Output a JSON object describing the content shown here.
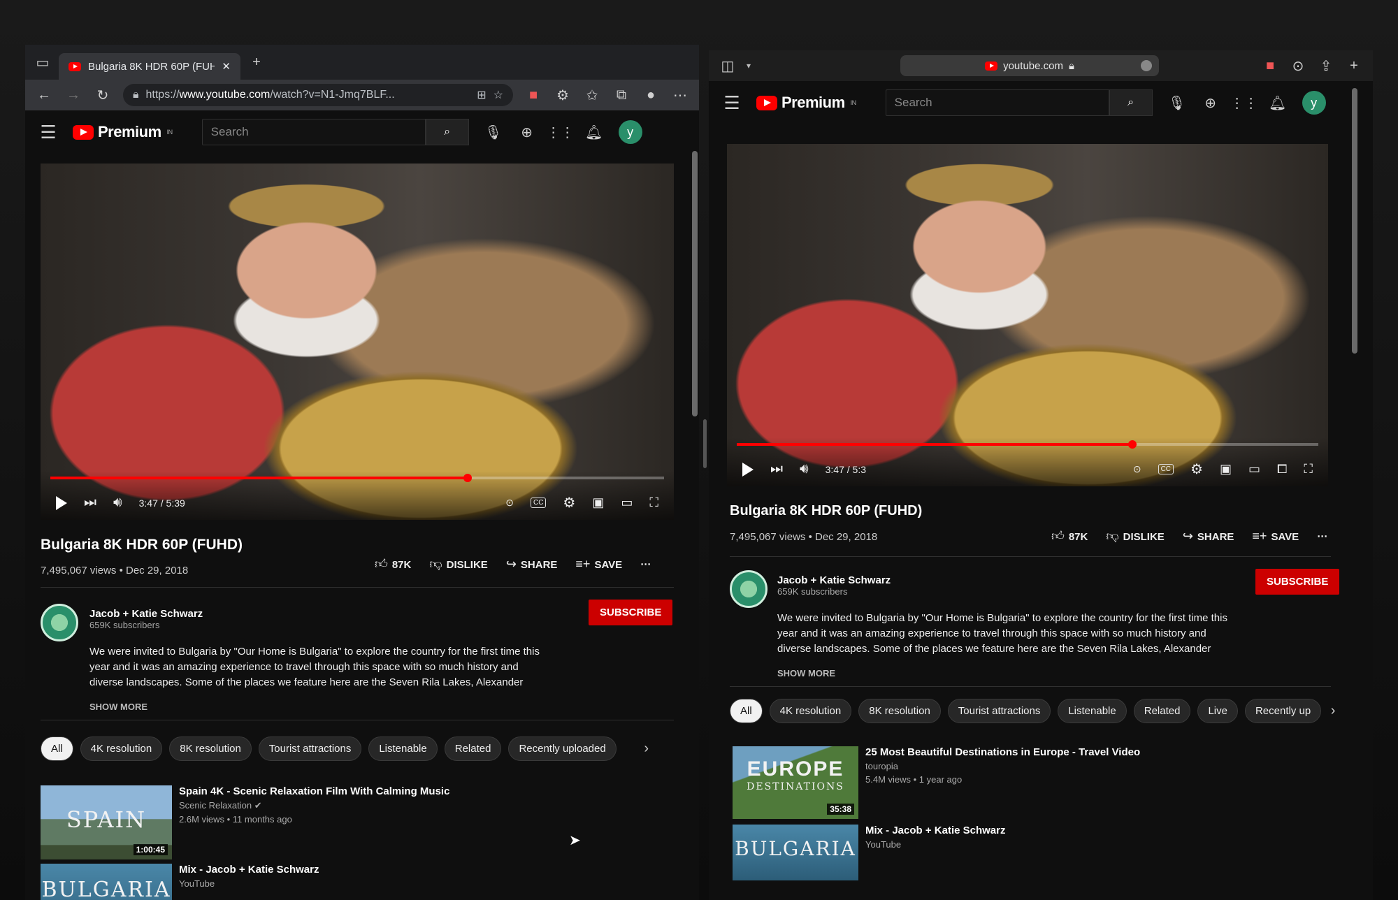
{
  "left": {
    "tab_title": "Bulgaria 8K HDR 60P (FUHD)",
    "url_prefix": "https://",
    "url_host": "www.youtube.com",
    "url_path": "/watch?v=N1-Jmq7BLF...",
    "logo_text": "Premium",
    "logo_region": "IN",
    "search_placeholder": "Search",
    "avatar_letter": "y",
    "time": "3:47 / 5:39",
    "progress": 0.68,
    "video_title": "Bulgaria 8K HDR 60P (FUHD)",
    "meta": "7,495,067 views • Dec 29, 2018",
    "likes": "87K",
    "dislike": "DISLIKE",
    "share": "SHARE",
    "save": "SAVE",
    "channel": "Jacob + Katie Schwarz",
    "subscribers": "659K subscribers",
    "subscribe": "SUBSCRIBE",
    "desc1": "We were invited to Bulgaria by \"Our Home is Bulgaria\" to explore the country for the first time this",
    "desc2": "year and it was an amazing experience to travel through this space with so much history and",
    "desc3": "diverse landscapes. Some of the places we feature here are the Seven Rila Lakes, Alexander",
    "show_more": "SHOW MORE",
    "chips": [
      "All",
      "4K resolution",
      "8K resolution",
      "Tourist attractions",
      "Listenable",
      "Related",
      "Recently uploaded"
    ],
    "rec1": {
      "title": "Spain 4K - Scenic Relaxation Film With Calming Music",
      "channel": "Scenic Relaxation",
      "meta": "2.6M views • 11 months ago",
      "duration": "1:00:45",
      "thumb_text": "SPAIN"
    },
    "rec2": {
      "title": "Mix - Jacob + Katie Schwarz",
      "channel": "YouTube",
      "thumb_text": "BULGARIA"
    }
  },
  "right": {
    "url": "youtube.com",
    "logo_text": "Premium",
    "logo_region": "IN",
    "search_placeholder": "Search",
    "avatar_letter": "y",
    "time": "3:47 / 5:3",
    "progress": 0.68,
    "video_title": "Bulgaria 8K HDR 60P (FUHD)",
    "meta": "7,495,067 views • Dec 29, 2018",
    "likes": "87K",
    "dislike": "DISLIKE",
    "share": "SHARE",
    "save": "SAVE",
    "channel": "Jacob + Katie Schwarz",
    "subscribers": "659K subscribers",
    "subscribe": "SUBSCRIBE",
    "desc1": "We were invited to Bulgaria by \"Our Home is Bulgaria\" to explore the country for the first time this",
    "desc2": "year and it was an amazing experience to travel through this space with so much history and",
    "desc3": "diverse landscapes. Some of the places we feature here are the Seven Rila Lakes, Alexander",
    "show_more": "SHOW MORE",
    "chips": [
      "All",
      "4K resolution",
      "8K resolution",
      "Tourist attractions",
      "Listenable",
      "Related",
      "Live",
      "Recently up"
    ],
    "rec1": {
      "title": "25 Most Beautiful Destinations in Europe - Travel Video",
      "channel": "touropia",
      "meta": "5.4M views • 1 year ago",
      "duration": "35:38",
      "thumb_text": "EUROPE",
      "thumb_sub": "DESTINATIONS"
    },
    "rec2": {
      "title": "Mix - Jacob + Katie Schwarz",
      "channel": "YouTube",
      "thumb_text": "BULGARIA"
    }
  },
  "colors": {
    "brand_red": "#ff0000",
    "subscribe_red": "#cc0000",
    "background": "#0f0f0f"
  }
}
